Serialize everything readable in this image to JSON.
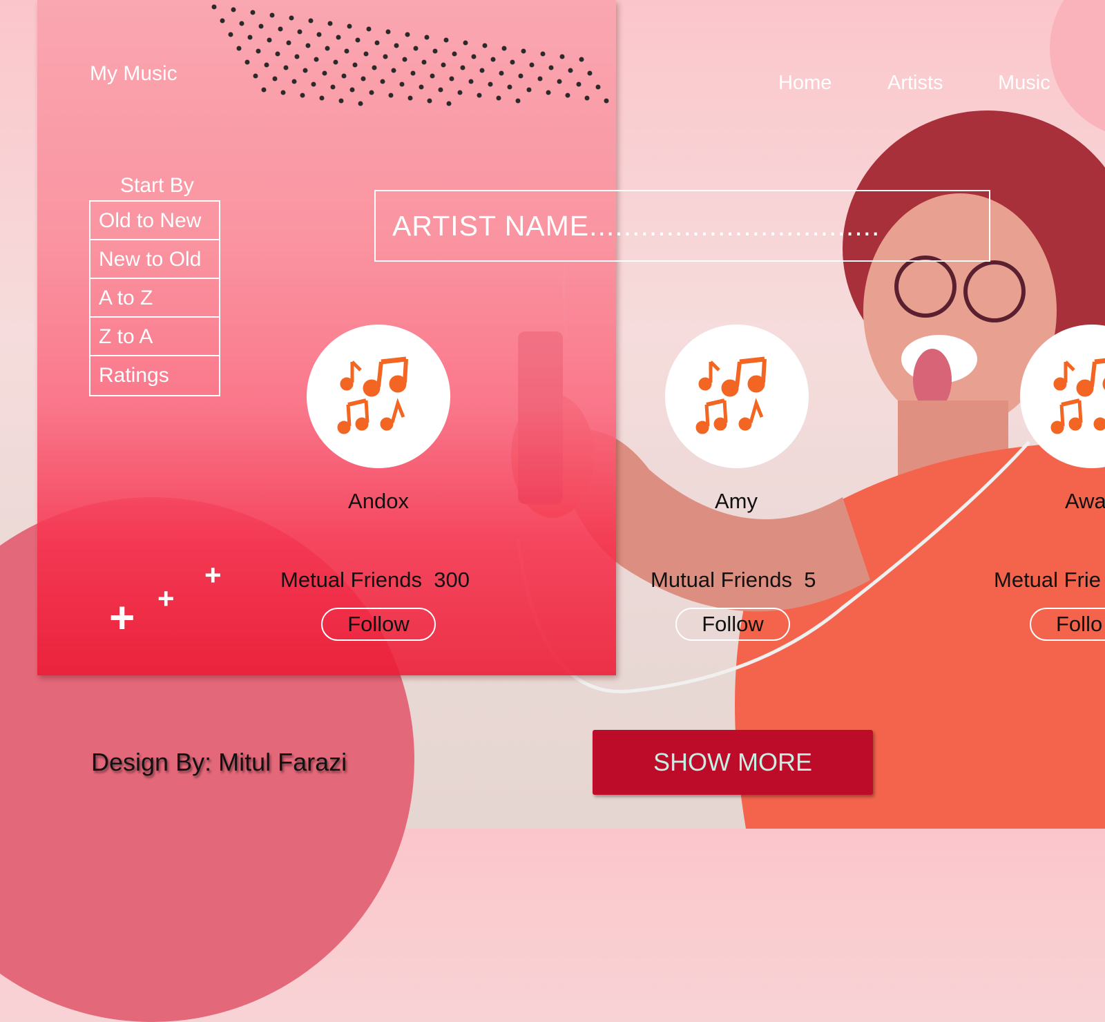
{
  "header": {
    "logo": "My Music",
    "nav": [
      {
        "label": "Home"
      },
      {
        "label": "Artists"
      },
      {
        "label": "Music"
      }
    ]
  },
  "sort": {
    "title": "Start By",
    "options": [
      "Old to New",
      "New to Old",
      "A to Z",
      "Z to A",
      "Ratings"
    ]
  },
  "search": {
    "placeholder": "ARTIST NAME.................................."
  },
  "artists": [
    {
      "name": "Andox",
      "friends_label": "Metual Friends",
      "friends_count": "300",
      "follow_label": "Follow",
      "icon": "music-notes-icon"
    },
    {
      "name": "Amy",
      "friends_label": "Mutual Friends",
      "friends_count": "5",
      "follow_label": "Follow",
      "icon": "music-notes-icon"
    },
    {
      "name": "Awa",
      "friends_label": "Metual Frie",
      "friends_count": "",
      "follow_label": "Follo",
      "icon": "music-notes-icon"
    }
  ],
  "footer": {
    "credit": "Design By: Mitul Farazi",
    "show_more": "SHOW MORE"
  },
  "colors": {
    "accent_red": "#bd0c2a",
    "icon_orange": "#f26522",
    "button_text": "#c6f0e3"
  }
}
